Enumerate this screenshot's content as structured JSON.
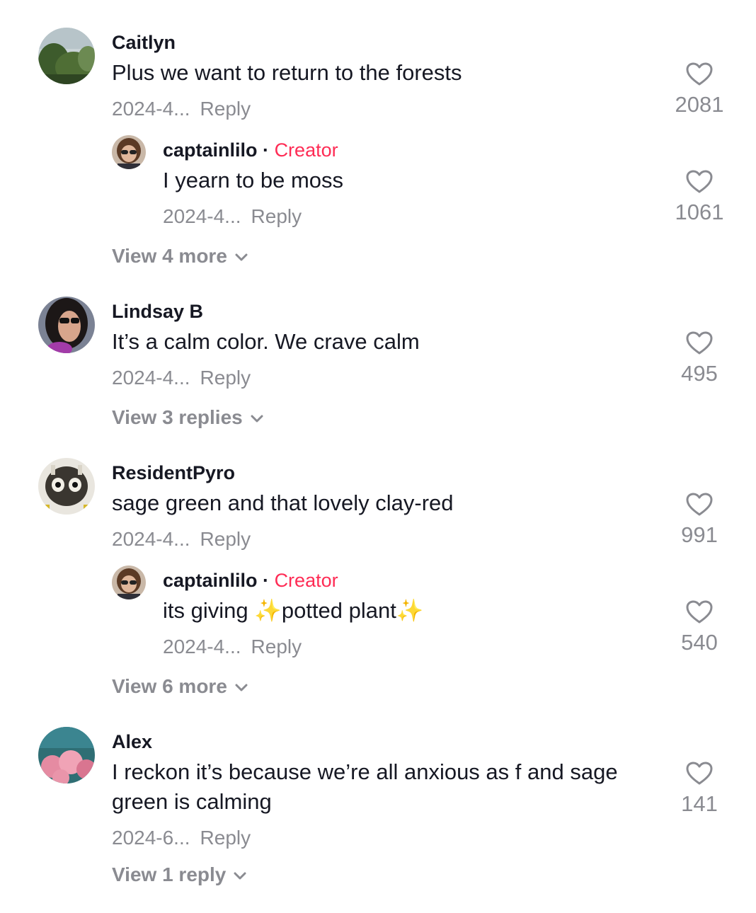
{
  "comments": [
    {
      "user": "Caitlyn",
      "avatar": "forest-tree-avatar",
      "text": "Plus we want to return to the forests",
      "date": "2024-4...",
      "reply_label": "Reply",
      "likes": "2081",
      "replies": [
        {
          "user": "captainlilo",
          "badge_sep": "·",
          "badge": "Creator",
          "text": "I yearn to be moss",
          "date": "2024-4...",
          "reply_label": "Reply",
          "likes": "1061"
        }
      ],
      "view_more": "View 4 more"
    },
    {
      "user": "Lindsay B",
      "avatar": "woman-sunglasses-avatar",
      "text": "It’s a calm color. We crave calm",
      "date": "2024-4...",
      "reply_label": "Reply",
      "likes": "495",
      "view_more": "View 3 replies"
    },
    {
      "user": "ResidentPyro",
      "avatar": "robot-helmet-avatar",
      "text": "sage green and that lovely clay-red",
      "date": "2024-4...",
      "reply_label": "Reply",
      "likes": "991",
      "replies": [
        {
          "user": "captainlilo",
          "badge_sep": "·",
          "badge": "Creator",
          "text_before": "its giving ",
          "sparkle": "✨",
          "text_mid": "potted plant",
          "date": "2024-4...",
          "reply_label": "Reply",
          "likes": "540"
        }
      ],
      "view_more": "View 6 more"
    },
    {
      "user": "Alex",
      "avatar": "pink-roses-avatar",
      "text": "I reckon it’s because we’re all anxious as f and sage green is calming",
      "date": "2024-6...",
      "reply_label": "Reply",
      "likes": "141",
      "view_more": "View 1 reply"
    }
  ],
  "colors": {
    "creator_badge": "#fe2c55",
    "secondary_text": "#8a8b91",
    "primary_text": "#161823"
  }
}
